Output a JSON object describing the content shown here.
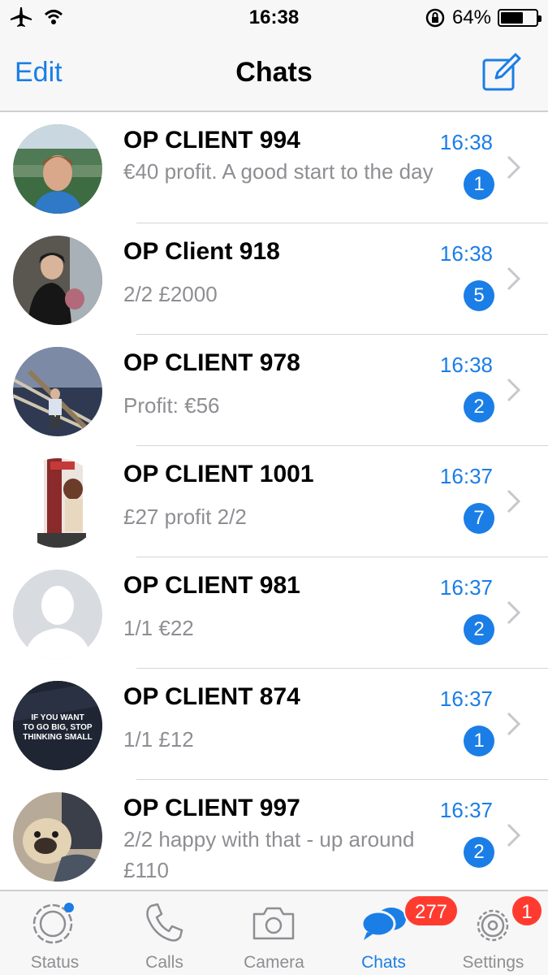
{
  "status_bar": {
    "time": "16:38",
    "battery_text": "64%",
    "battery_level": 0.64,
    "icons": [
      "airplane-icon",
      "wifi-icon",
      "rotation-lock-icon",
      "battery-icon"
    ]
  },
  "nav": {
    "edit_label": "Edit",
    "title": "Chats",
    "compose_icon": "compose-icon"
  },
  "colors": {
    "accent": "#1a7ee6",
    "badge_red": "#ff3b30",
    "muted": "#8e8e93"
  },
  "chats": [
    {
      "name": "OP CLIENT 994",
      "time": "16:38",
      "preview": "€40 profit. A good start to the day",
      "unread": "1",
      "avatar": "photo-man-outdoors"
    },
    {
      "name": "OP Client 918",
      "time": "16:38",
      "preview": "2/2  £2000",
      "unread": "5",
      "avatar": "photo-couple"
    },
    {
      "name": "OP CLIENT 978",
      "time": "16:38",
      "preview": "Profit: €56",
      "unread": "2",
      "avatar": "photo-rope-bridge"
    },
    {
      "name": "OP CLIENT 1001",
      "time": "16:37",
      "preview": "£27 profit 2/2",
      "unread": "7",
      "avatar": "photo-doorway"
    },
    {
      "name": "OP CLIENT 981",
      "time": "16:37",
      "preview": "1/1 €22",
      "unread": "2",
      "avatar": "default-avatar-silhouette"
    },
    {
      "name": "OP CLIENT 874",
      "time": "16:37",
      "preview": "1/1 £12",
      "unread": "1",
      "avatar": "quote-image"
    },
    {
      "name": "OP CLIENT 997",
      "time": "16:37",
      "preview": "2/2 happy with that - up around £110",
      "unread": "2",
      "avatar": "photo-pug"
    }
  ],
  "avatar_874_text": "IF YOU WANT TO GO BIG, STOP THINKING SMALL",
  "tabs": [
    {
      "label": "Status",
      "icon": "status-icon",
      "active": false,
      "badge": ""
    },
    {
      "label": "Calls",
      "icon": "phone-icon",
      "active": false,
      "badge": ""
    },
    {
      "label": "Camera",
      "icon": "camera-icon",
      "active": false,
      "badge": ""
    },
    {
      "label": "Chats",
      "icon": "chat-bubbles-icon",
      "active": true,
      "badge": "277"
    },
    {
      "label": "Settings",
      "icon": "gear-icon",
      "active": false,
      "badge": "1"
    }
  ]
}
